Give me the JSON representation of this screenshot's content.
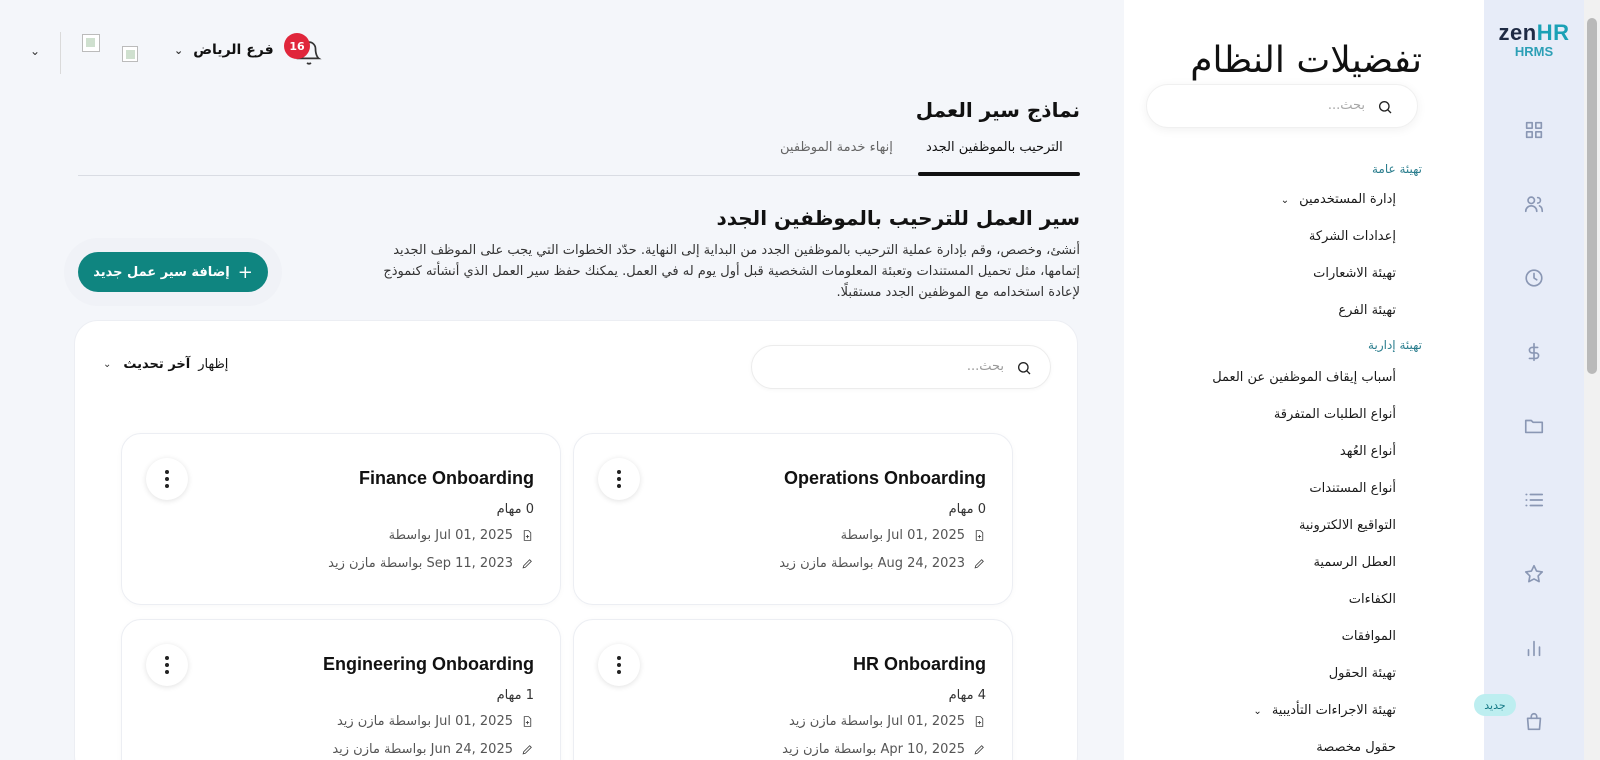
{
  "rail": {
    "logo_z": "zen",
    "logo_hr": "HR",
    "logo_sub": "HRMS",
    "icons": [
      "grid-icon",
      "users-icon",
      "clock-icon",
      "dollar-icon",
      "folder-icon",
      "list-icon",
      "star-icon",
      "bar-chart-icon",
      "shopping-bag-icon"
    ],
    "new_badge": "جديد"
  },
  "panel": {
    "title": "تفضيلات النظام",
    "search_placeholder": "بحث...",
    "groups": [
      {
        "label": "تهيئة عامة",
        "items": [
          {
            "label": "إدارة المستخدمين",
            "expandable": true
          },
          {
            "label": "إعدادات الشركة",
            "expandable": false
          },
          {
            "label": "تهيئة الاشعارات",
            "expandable": false
          },
          {
            "label": "تهيئة الفرع",
            "expandable": false
          }
        ]
      },
      {
        "label": "تهيئة إدارية",
        "items": [
          {
            "label": "أسباب إيقاف الموظفين عن العمل",
            "expandable": false
          },
          {
            "label": "أنواع الطلبات المتفرقة",
            "expandable": false
          },
          {
            "label": "أنواع العُهد",
            "expandable": false
          },
          {
            "label": "أنواع المستندات",
            "expandable": false
          },
          {
            "label": "التواقيع الالكترونية",
            "expandable": false
          },
          {
            "label": "العطل الرسمية",
            "expandable": false
          },
          {
            "label": "الكفاءات",
            "expandable": false
          },
          {
            "label": "الموافقات",
            "expandable": false
          },
          {
            "label": "تهيئة الحقول",
            "expandable": false
          },
          {
            "label": "تهيئة الاجراءات التأديبية",
            "expandable": true
          },
          {
            "label": "حقول مخصصة",
            "expandable": false
          }
        ]
      }
    ]
  },
  "topbar": {
    "notification_count": "16",
    "branch": "فرع الرياض"
  },
  "main": {
    "section_title": "نماذج سير العمل",
    "tabs": [
      {
        "label": "الترحيب بالموظفين الجدد",
        "active": true
      },
      {
        "label": "إنهاء خدمة الموظفين",
        "active": false
      }
    ],
    "workflow_title": "سير العمل للترحيب بالموظفين الجدد",
    "workflow_desc": "أنشئ، وخصص، وقم بإدارة عملية الترحيب بالموظفين الجدد من البداية إلى النهاية. حدّد الخطوات التي يجب على الموظف الجديد إتمامها، مثل تحميل المستندات وتعبئة المعلومات الشخصية قبل أول يوم له في العمل. يمكنك حفظ سير العمل الذي أنشأته كنموذج لإعادة استخدامه مع الموظفين الجدد مستقبلًا.",
    "add_button": "إضافة سير عمل جديد",
    "list": {
      "search_placeholder": "بحث...",
      "sort_label": "إظهار",
      "sort_value": "آخر تحديث",
      "cards": [
        {
          "name": "Operations Onboarding",
          "tasks": "0 مهام",
          "created": "Jul 01, 2025 بواسطة",
          "updated": "Aug 24, 2023 بواسطة مازن زيد"
        },
        {
          "name": "Finance Onboarding",
          "tasks": "0 مهام",
          "created": "Jul 01, 2025 بواسطة",
          "updated": "Sep 11, 2023 بواسطة مازن زيد"
        },
        {
          "name": "HR Onboarding",
          "tasks": "4 مهام",
          "created": "Jul 01, 2025 بواسطة مازن زيد",
          "updated": "Apr 10, 2025 بواسطة مازن زيد"
        },
        {
          "name": "Engineering Onboarding",
          "tasks": "1 مهام",
          "created": "Jul 01, 2025 بواسطة مازن زيد",
          "updated": "Jun 24, 2025 بواسطة مازن زيد"
        }
      ]
    }
  }
}
